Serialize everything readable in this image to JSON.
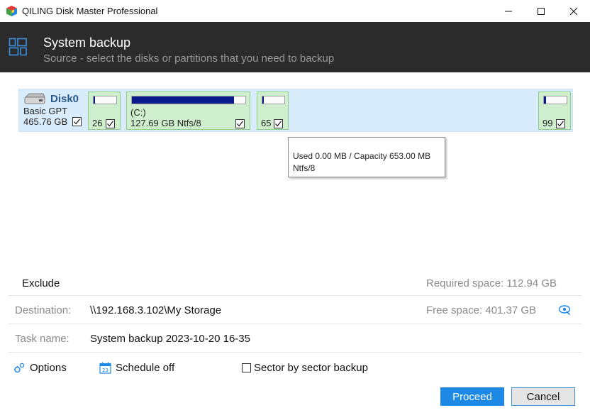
{
  "window": {
    "title": "QILING Disk Master Professional",
    "icon": "app-cube-icon",
    "controls": [
      "minimize-icon",
      "maximize-icon",
      "close-icon"
    ]
  },
  "header": {
    "title": "System backup",
    "subtitle": "Source - select the disks or partitions that you need to backup",
    "icon": "grid-icon"
  },
  "disk": {
    "name": "Disk0",
    "type": "Basic GPT",
    "size": "465.76 GB",
    "checked": true,
    "partitions": [
      {
        "label": "26",
        "checked": true,
        "usage_fraction": 0.05
      },
      {
        "label_top": "(C:)",
        "label": "127.69 GB Ntfs/8",
        "checked": true,
        "usage_fraction": 0.9
      },
      {
        "label": "65",
        "checked": true,
        "usage_fraction": 0.05
      },
      {
        "label": "99",
        "checked": true,
        "usage_fraction": 0.08
      }
    ]
  },
  "tooltip": {
    "line1": "Used 0.00 MB / Capacity 653.00 MB",
    "line2": "Ntfs/8"
  },
  "exclude": {
    "label": "Exclude",
    "required_space": "Required space: 112.94 GB"
  },
  "destination": {
    "label": "Destination:",
    "value": "\\\\192.168.3.102\\My Storage",
    "free_space": "Free space: 401.37 GB",
    "browse_icon": "browse-icon"
  },
  "task": {
    "label": "Task name:",
    "value": "System backup 2023-10-20 16-35"
  },
  "options": {
    "options_label": "Options",
    "schedule_label": "Schedule off",
    "sector_label": "Sector by sector backup",
    "sector_checked": false
  },
  "buttons": {
    "proceed": "Proceed",
    "cancel": "Cancel"
  },
  "colors": {
    "header_bg": "#2b2b2b",
    "disk_row_bg": "#d9ecfb",
    "partition_bg": "#cfeecd",
    "usage_fill": "#0a1a8a",
    "accent": "#1e88e5"
  }
}
